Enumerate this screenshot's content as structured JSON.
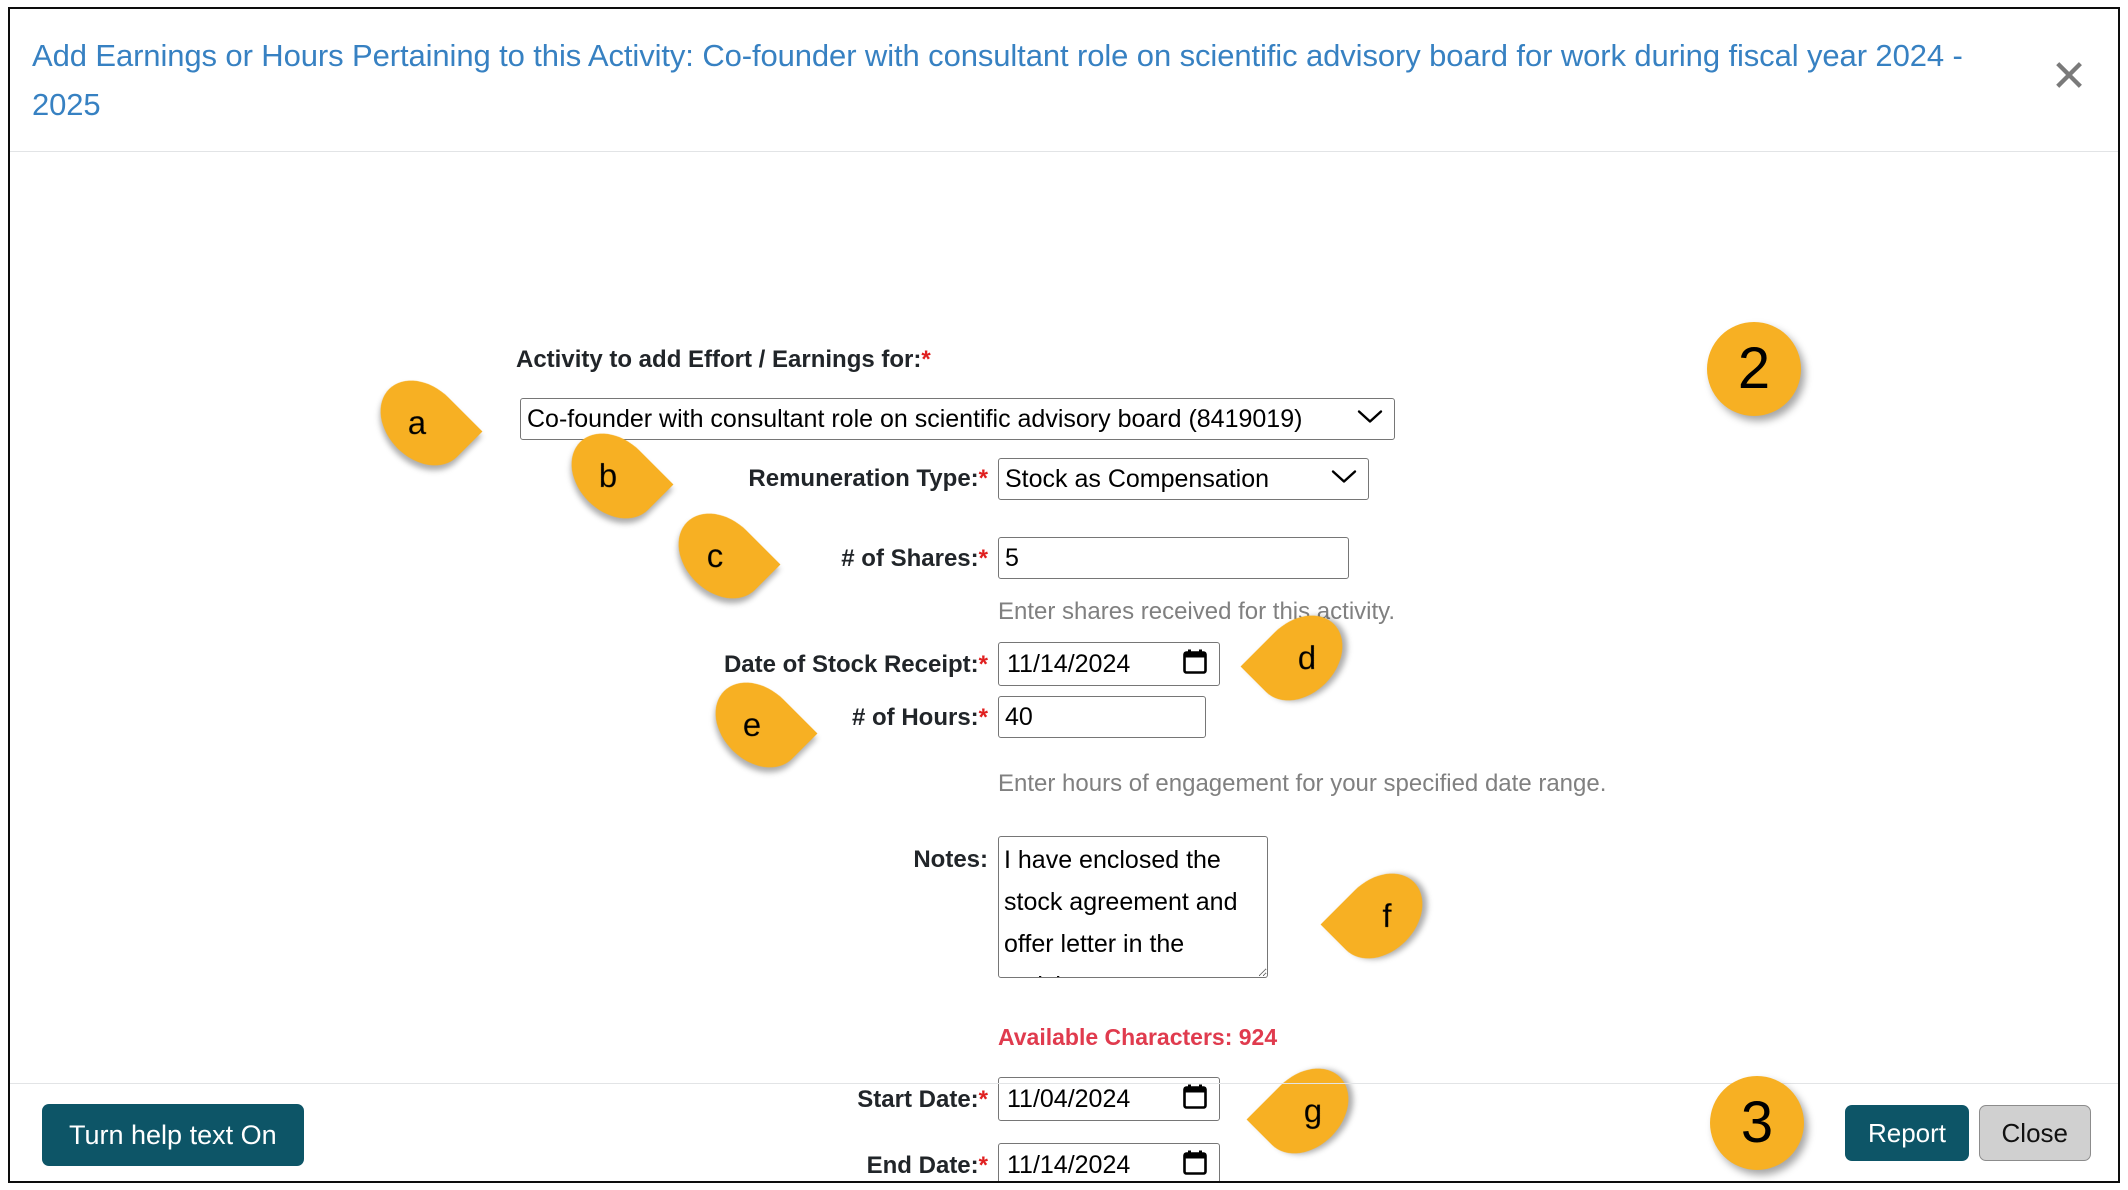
{
  "dialog": {
    "title": "Add Earnings or Hours Pertaining to this Activity: Co-founder with consultant role on scientific advisory board for work during fiscal year 2024 - 2025",
    "close_icon": "✕"
  },
  "form": {
    "activity": {
      "label": "Activity to add Effort / Earnings for:",
      "required_mark": "*",
      "value": "Co-founder with consultant role on scientific advisory board (8419019)"
    },
    "remuneration": {
      "label": "Remuneration Type:",
      "required_mark": "*",
      "value": "Stock as Compensation"
    },
    "shares": {
      "label": "# of Shares:",
      "required_mark": "*",
      "value": "5",
      "help": "Enter shares received for this activity."
    },
    "stock_receipt_date": {
      "label": "Date of Stock Receipt:",
      "required_mark": "*",
      "value": "11/14/2024"
    },
    "hours": {
      "label": "# of Hours:",
      "required_mark": "*",
      "value": "40",
      "help": "Enter hours of engagement for your specified date range."
    },
    "notes": {
      "label": "Notes:",
      "value": "I have enclosed the stock agreement and offer letter in the activity notes.",
      "available_characters": "Available Characters: 924"
    },
    "start_date": {
      "label": "Start Date:",
      "required_mark": "*",
      "value": "11/04/2024"
    },
    "end_date": {
      "label": "End Date:",
      "required_mark": "*",
      "value": "11/14/2024"
    }
  },
  "footer": {
    "help_toggle": "Turn help text On",
    "report": "Report",
    "close": "Close"
  },
  "annotations": {
    "a": "a",
    "b": "b",
    "c": "c",
    "d": "d",
    "e": "e",
    "f": "f",
    "g": "g",
    "step2": "2",
    "step3": "3"
  },
  "colors": {
    "title_blue": "#3781c2",
    "marker_yellow": "#f7b023",
    "button_teal": "#0d5567",
    "required_red": "#e02020",
    "available_red": "#e03b4e"
  }
}
